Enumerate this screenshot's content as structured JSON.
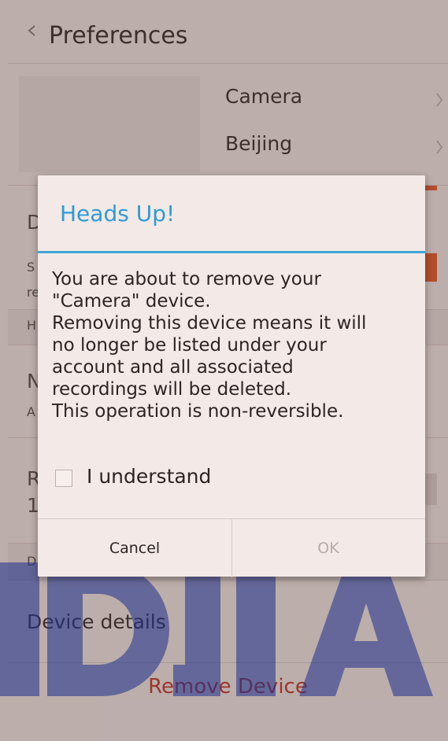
{
  "header": {
    "title": "Preferences",
    "back_icon": "chevron-left-icon"
  },
  "device": {
    "name": "Camera",
    "location": "Beijing"
  },
  "background": {
    "partial_letters": [
      "D",
      "S",
      "re",
      "H",
      "N",
      "A",
      "R",
      "1",
      "D"
    ],
    "device_details": "Device details",
    "remove_device": "Remove Device"
  },
  "dialog": {
    "title": "Heads Up!",
    "message_lines": [
      "You are about to remove your",
      "\"Camera\" device.",
      "Removing this device means it will",
      "no longer be listed under your",
      "account and all associated",
      "recordings will be deleted.",
      "This operation is non-reversible."
    ],
    "checkbox_label": "I understand",
    "checkbox_checked": false,
    "cancel_label": "Cancel",
    "ok_label": "OK"
  },
  "colors": {
    "accent": "#41a6d9",
    "danger": "#c0392b",
    "orange": "#e25a2b"
  }
}
